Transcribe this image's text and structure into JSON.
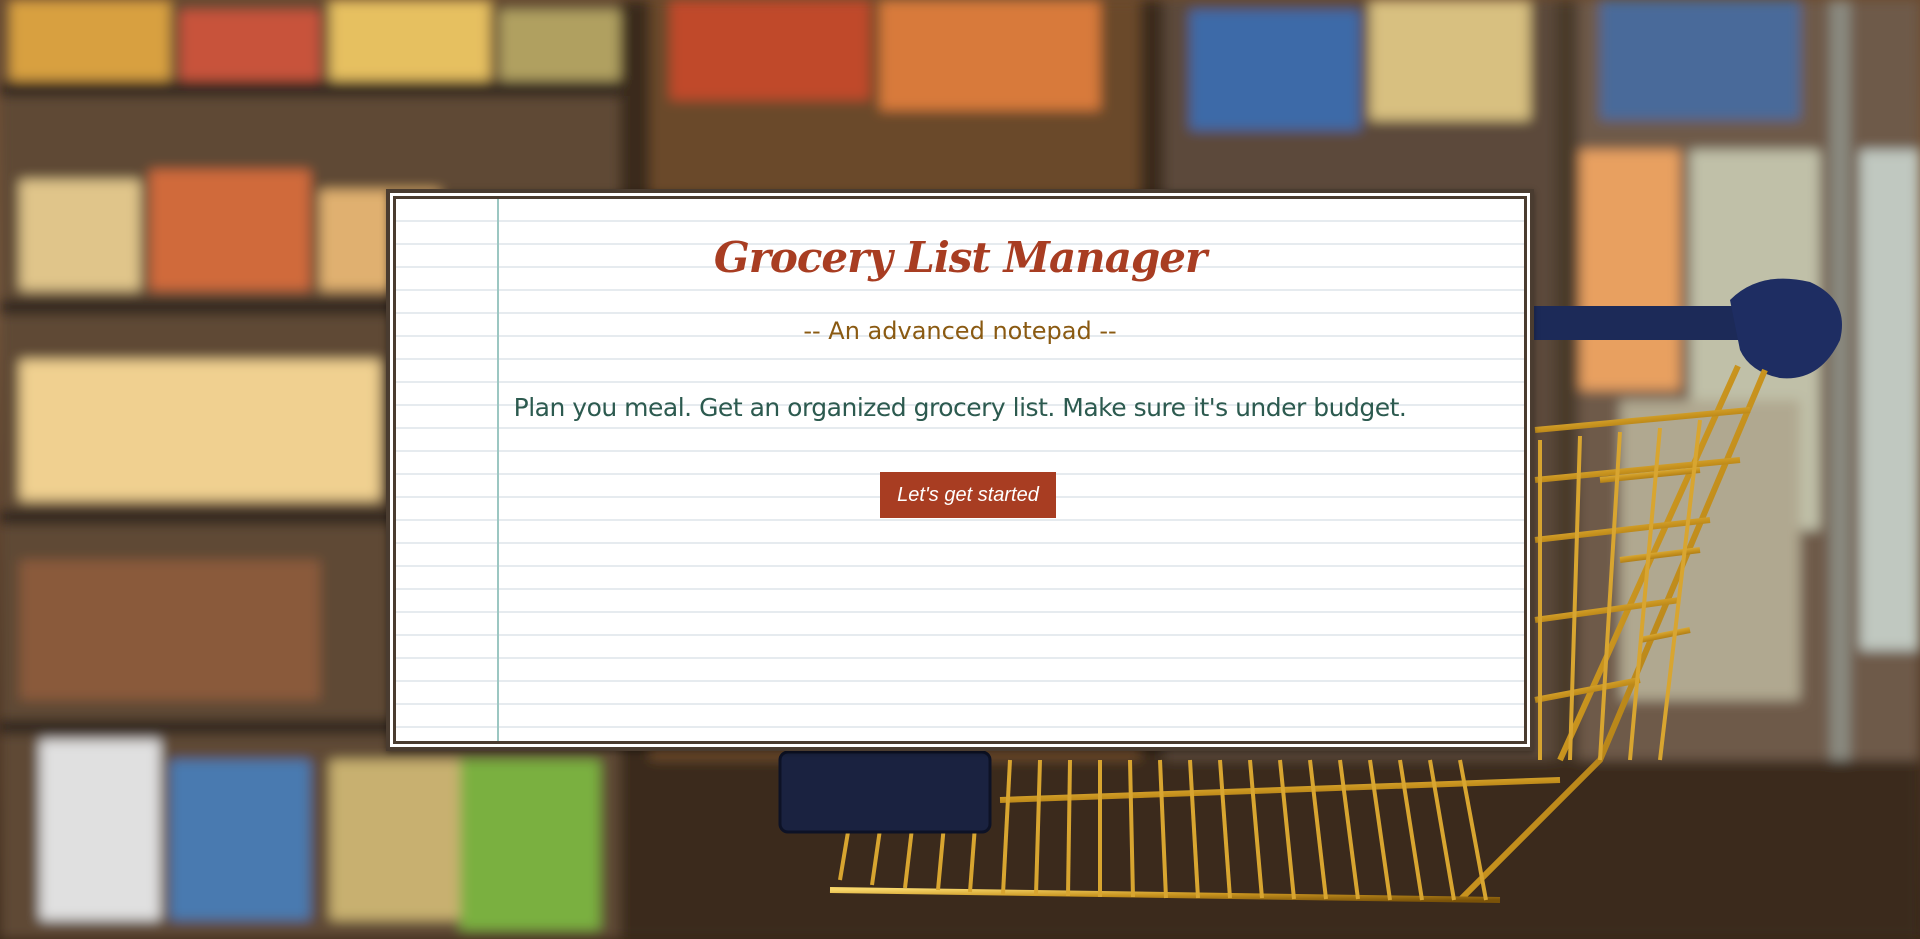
{
  "app": {
    "title": "Grocery List Manager",
    "subtitle": "-- An advanced notepad --",
    "tagline": "Plan you meal. Get an organized grocery list. Make sure it's under budget.",
    "cta_label": "Let's get started"
  },
  "background": {
    "description_icon": "shopping-cart-photo"
  },
  "colors": {
    "title": "#a83d22",
    "subtitle": "#8a5a12",
    "tagline": "#2c5a4f",
    "button_bg": "#a83d22",
    "button_text": "#ffffff",
    "card_border": "#4a3c30",
    "margin_line": "#9cc7c2",
    "ruled_line": "#e6ebef"
  }
}
